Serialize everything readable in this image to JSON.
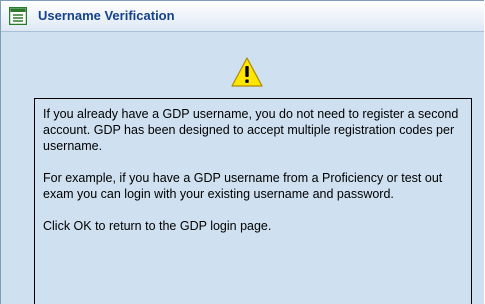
{
  "dialog": {
    "title": "Username Verification",
    "title_icon": "form-icon",
    "alert_icon": "warning-icon",
    "paragraphs": [
      "If you already have a GDP username, you do not need to register a second account. GDP has been designed to accept multiple registration codes per username.",
      "For example, if you have a GDP username from a Proficiency or test out exam you can login with your existing username and password.",
      "Click OK to return to the GDP login page."
    ]
  },
  "colors": {
    "background": "#cfe0f0",
    "title_text": "#15428b",
    "warning_yellow": "#ffe600"
  }
}
